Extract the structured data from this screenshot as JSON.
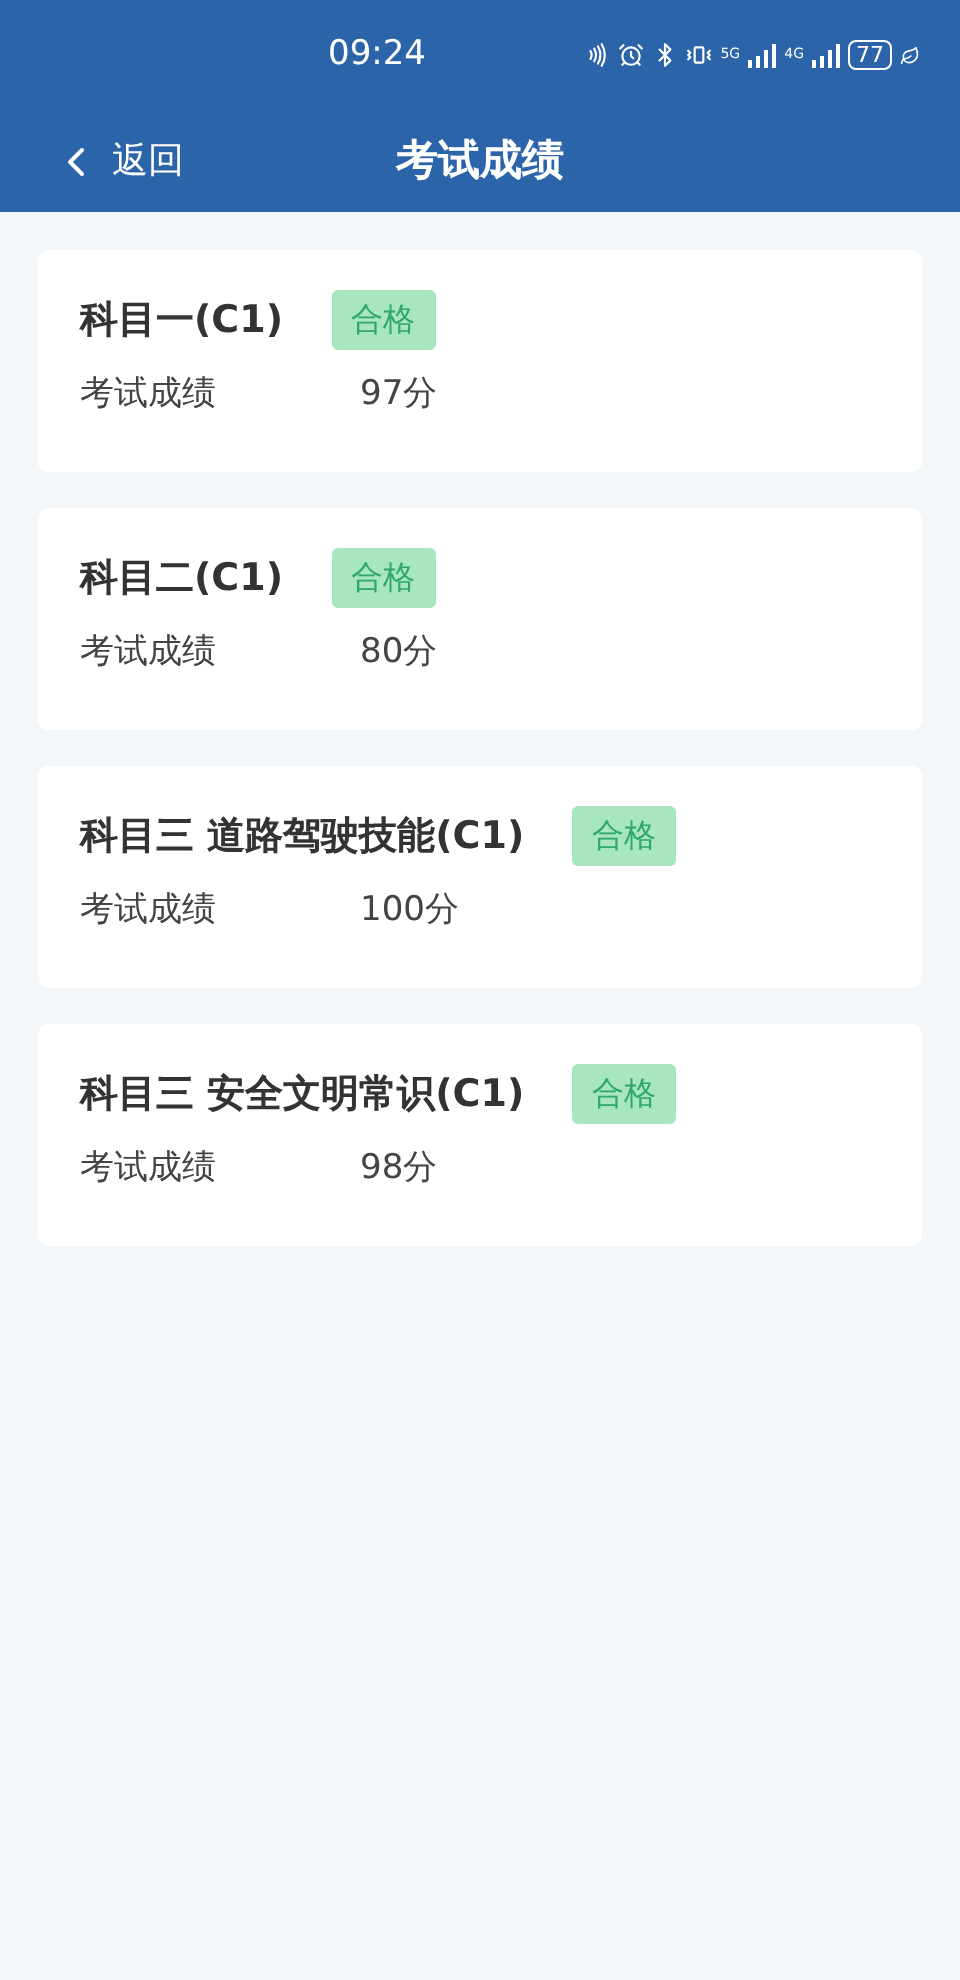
{
  "status_bar": {
    "time": "09:24",
    "network_1": "5G",
    "network_2": "4G",
    "battery": "77"
  },
  "nav": {
    "back": "返回",
    "title": "考试成绩"
  },
  "results": [
    {
      "subject": "科目一(C1)",
      "status": "合格",
      "passed": true,
      "score_label": "考试成绩",
      "score": "97分"
    },
    {
      "subject": "科目二(C1)",
      "status": "合格",
      "passed": true,
      "score_label": "考试成绩",
      "score": "80分"
    },
    {
      "subject": "科目三 道路驾驶技能(C1)",
      "status": "合格",
      "passed": true,
      "score_label": "考试成绩",
      "score": "100分"
    },
    {
      "subject": "科目三 安全文明常识(C1)",
      "status": "合格",
      "passed": true,
      "score_label": "考试成绩",
      "score": "98分"
    }
  ]
}
